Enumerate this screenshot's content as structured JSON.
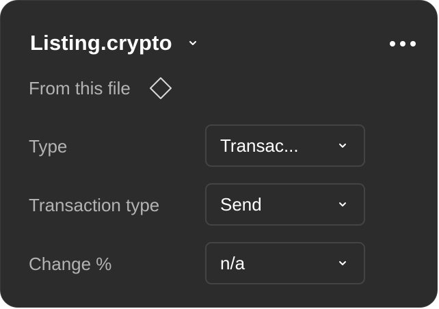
{
  "component": {
    "name": "Listing.crypto",
    "name_dropdown_icon": "chevron-down-icon",
    "more_icon": "more-horizontal-icon"
  },
  "source": {
    "label": "From this file",
    "icon": "component-diamond-icon"
  },
  "properties": [
    {
      "label": "Type",
      "value": "Transac...",
      "icon": "chevron-down-icon"
    },
    {
      "label": "Transaction type",
      "value": "Send",
      "icon": "chevron-down-icon"
    },
    {
      "label": "Change %",
      "value": "n/a",
      "icon": "chevron-down-icon"
    }
  ],
  "colors": {
    "panel_background": "#2c2c2c",
    "label_text": "#b3b3b3",
    "value_text": "#ffffff",
    "select_border": "#444444"
  }
}
